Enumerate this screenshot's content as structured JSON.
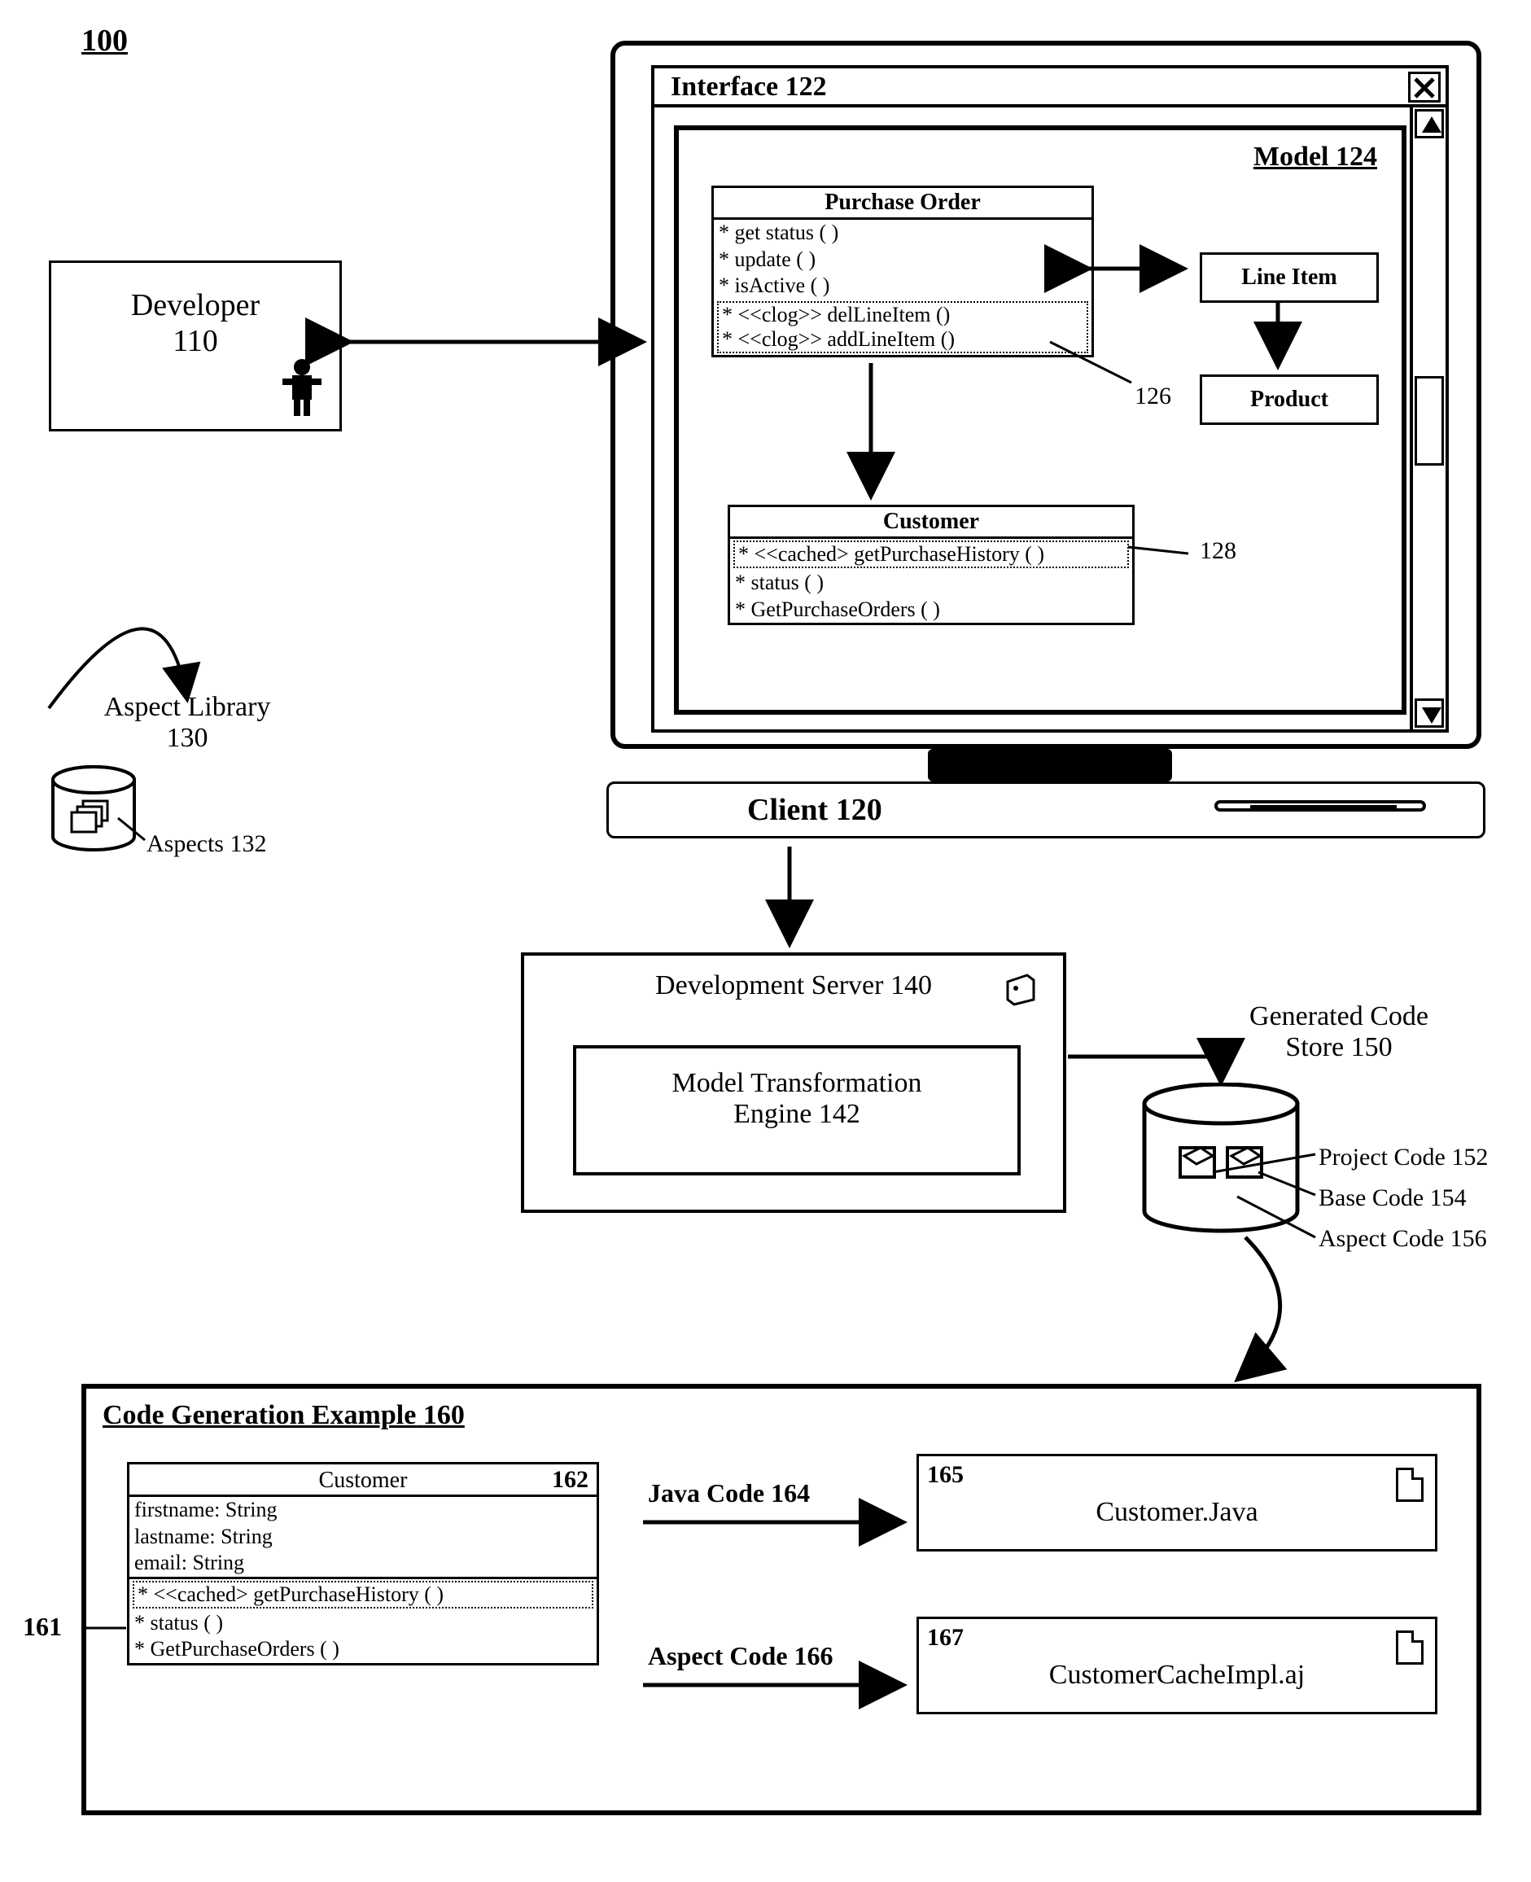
{
  "figure": {
    "ref": "100"
  },
  "developer": {
    "label": "Developer",
    "ref": "110"
  },
  "client": {
    "label": "Client",
    "ref": "120",
    "interface": {
      "label": "Interface",
      "ref": "122"
    },
    "model": {
      "label": "Model",
      "ref": "124",
      "purchaseOrder": {
        "title": "Purchase Order",
        "methods": [
          "* get status ( )",
          "* update ( )",
          "* isActive ( )"
        ],
        "aspectMethods": [
          "* <<clog>> delLineItem ()",
          "* <<clog>> addLineItem ()"
        ],
        "aspectRef": "126"
      },
      "customer": {
        "title": "Customer",
        "aspectMethod": "* <<cached> getPurchaseHistory ( )",
        "aspectRef": "128",
        "methods": [
          "* status ( )",
          "* GetPurchaseOrders ( )"
        ]
      },
      "lineItem": {
        "title": "Line Item"
      },
      "product": {
        "title": "Product"
      }
    }
  },
  "aspectLibrary": {
    "label": "Aspect Library",
    "ref": "130",
    "aspects": {
      "label": "Aspects",
      "ref": "132"
    }
  },
  "devServer": {
    "label": "Development Server",
    "ref": "140",
    "engine": {
      "label1": "Model Transformation",
      "label2": "Engine",
      "ref": "142"
    }
  },
  "store": {
    "label1": "Generated Code",
    "label2": "Store",
    "ref": "150",
    "projectCode": {
      "label": "Project Code",
      "ref": "152"
    },
    "baseCode": {
      "label": "Base Code",
      "ref": "154"
    },
    "aspectCode": {
      "label": "Aspect Code",
      "ref": "156"
    }
  },
  "example": {
    "title": "Code Generation Example",
    "ref": "160",
    "ref161": "161",
    "customerBox": {
      "ref": "162",
      "title": "Customer",
      "attrs": [
        "firstname: String",
        "lastname: String",
        "email: String"
      ],
      "aspectMethod": "* <<cached> getPurchaseHistory ( )",
      "methods": [
        "* status ( )",
        "* GetPurchaseOrders ( )"
      ]
    },
    "javaCode": {
      "label": "Java Code",
      "ref": "164"
    },
    "aspectCode": {
      "label": "Aspect Code",
      "ref": "166"
    },
    "file1": {
      "ref": "165",
      "name": "Customer.Java"
    },
    "file2": {
      "ref": "167",
      "name": "CustomerCacheImpl.aj"
    }
  }
}
